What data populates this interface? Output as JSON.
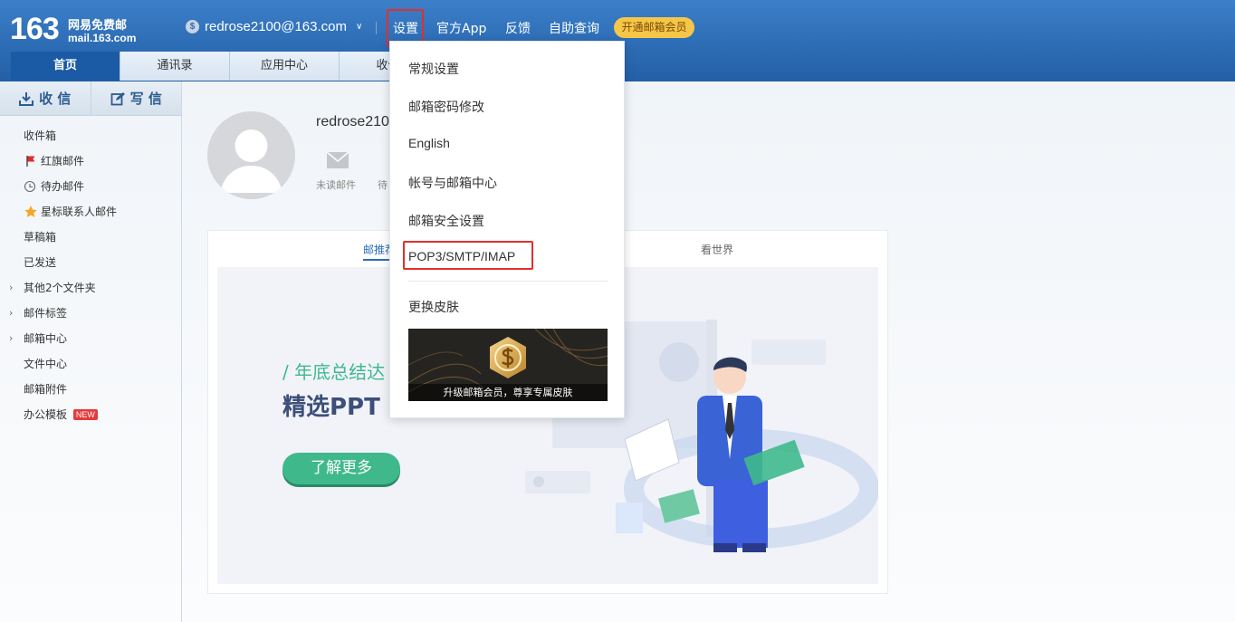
{
  "header": {
    "logo_number": "163",
    "logo_cn": "网易免费邮",
    "logo_en": "mail.163.com",
    "account_email": "redrose2100@163.com",
    "coin_symbol": "$",
    "nav": [
      "设置",
      "官方App",
      "反馈",
      "自助查询"
    ],
    "vip_button": "开通邮箱会员"
  },
  "tabs": [
    {
      "label": "首页",
      "active": true
    },
    {
      "label": "通讯录",
      "active": false
    },
    {
      "label": "应用中心",
      "active": false
    },
    {
      "label": "收件箱",
      "active": false
    }
  ],
  "sidebar": {
    "receive_label": "收 信",
    "compose_label": "写 信",
    "folders": [
      {
        "label": "收件箱",
        "icon": ""
      },
      {
        "label": "红旗邮件",
        "icon": "red-flag-icon"
      },
      {
        "label": "待办邮件",
        "icon": "clock-icon"
      },
      {
        "label": "星标联系人邮件",
        "icon": "star-icon"
      },
      {
        "label": "草稿箱",
        "icon": ""
      },
      {
        "label": "已发送",
        "icon": ""
      },
      {
        "label": "其他2个文件夹",
        "icon": "",
        "expandable": true
      },
      {
        "label": "邮件标签",
        "icon": "",
        "expandable": true
      },
      {
        "label": "邮箱中心",
        "icon": "",
        "expandable": true
      },
      {
        "label": "文件中心",
        "icon": ""
      },
      {
        "label": "邮箱附件",
        "icon": ""
      },
      {
        "label": "办公模板",
        "icon": "",
        "badge": "NEW"
      }
    ]
  },
  "profile": {
    "username": "redrose210",
    "unread_label": "未读邮件",
    "todo_label": "待"
  },
  "content": {
    "subtab_active": "邮推荐",
    "subtab_right": "看世界",
    "banner_small": "/ 年底总结达",
    "banner_big": "精选PPT",
    "banner_button": "了解更多"
  },
  "dropdown": {
    "items": [
      "常规设置",
      "邮箱密码修改",
      "English",
      "帐号与邮箱中心",
      "邮箱安全设置",
      "POP3/SMTP/IMAP",
      "更换皮肤"
    ],
    "highlighted": "POP3/SMTP/IMAP",
    "promo_text": "升级邮箱会员，尊享专属皮肤"
  },
  "colors": {
    "header_blue": "#2d6db6",
    "tab_active": "#1b5aa5",
    "vip_yellow": "#f6c648",
    "highlight_red": "#e0302c",
    "banner_green": "#3fb98c"
  }
}
